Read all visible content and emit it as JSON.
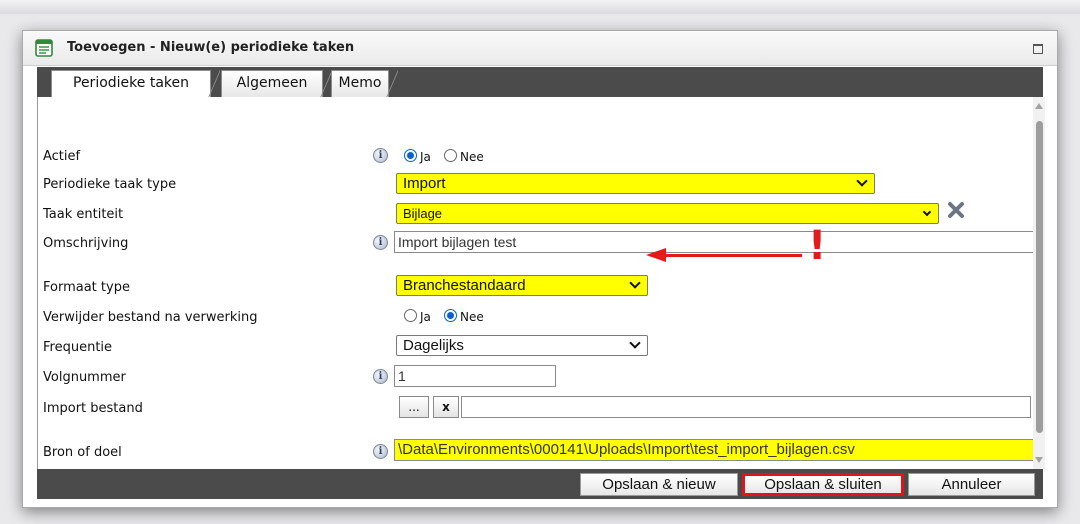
{
  "window": {
    "title": "Toevoegen - Nieuw(e) periodieke taken"
  },
  "tabs": [
    {
      "label": "Periodieke taken",
      "active": true
    },
    {
      "label": "Algemeen",
      "active": false
    },
    {
      "label": "Memo",
      "active": false
    }
  ],
  "form": {
    "actief": {
      "label": "Actief",
      "option_yes": "Ja",
      "option_no": "Nee",
      "selected": "Ja"
    },
    "taak_type": {
      "label": "Periodieke taak type",
      "value": "Import"
    },
    "taak_entiteit": {
      "label": "Taak entiteit",
      "value": "Bijlage"
    },
    "omschrijving": {
      "label": "Omschrijving",
      "value": "Import bijlagen test"
    },
    "formaat_type": {
      "label": "Formaat type",
      "value": "Branchestandaard"
    },
    "verwijder": {
      "label": "Verwijder bestand na verwerking",
      "option_yes": "Ja",
      "option_no": "Nee",
      "selected": "Nee"
    },
    "frequentie": {
      "label": "Frequentie",
      "value": "Dagelijks"
    },
    "volgnummer": {
      "label": "Volgnummer",
      "value": "1"
    },
    "import_bestand": {
      "label": "Import bestand",
      "browse": "...",
      "clear": "x",
      "value": ""
    },
    "bron_doel": {
      "label": "Bron of doel",
      "value": "\\Data\\Environments\\000141\\Uploads\\Import\\test_import_bijlagen.csv"
    }
  },
  "annotation": {
    "mark": "!"
  },
  "footer": {
    "save_new": "Opslaan & nieuw",
    "save_close": "Opslaan & sluiten",
    "cancel": "Annuleer"
  },
  "colors": {
    "highlight_field": "#ffff00",
    "toolbar": "#4b4b4b",
    "annotation_red": "#e21b1b",
    "radio_selected": "#0a5fd6"
  },
  "icons": {
    "title": "form-icon",
    "info": "info-icon",
    "clear": "close-icon",
    "maximize": "maximize-icon"
  }
}
